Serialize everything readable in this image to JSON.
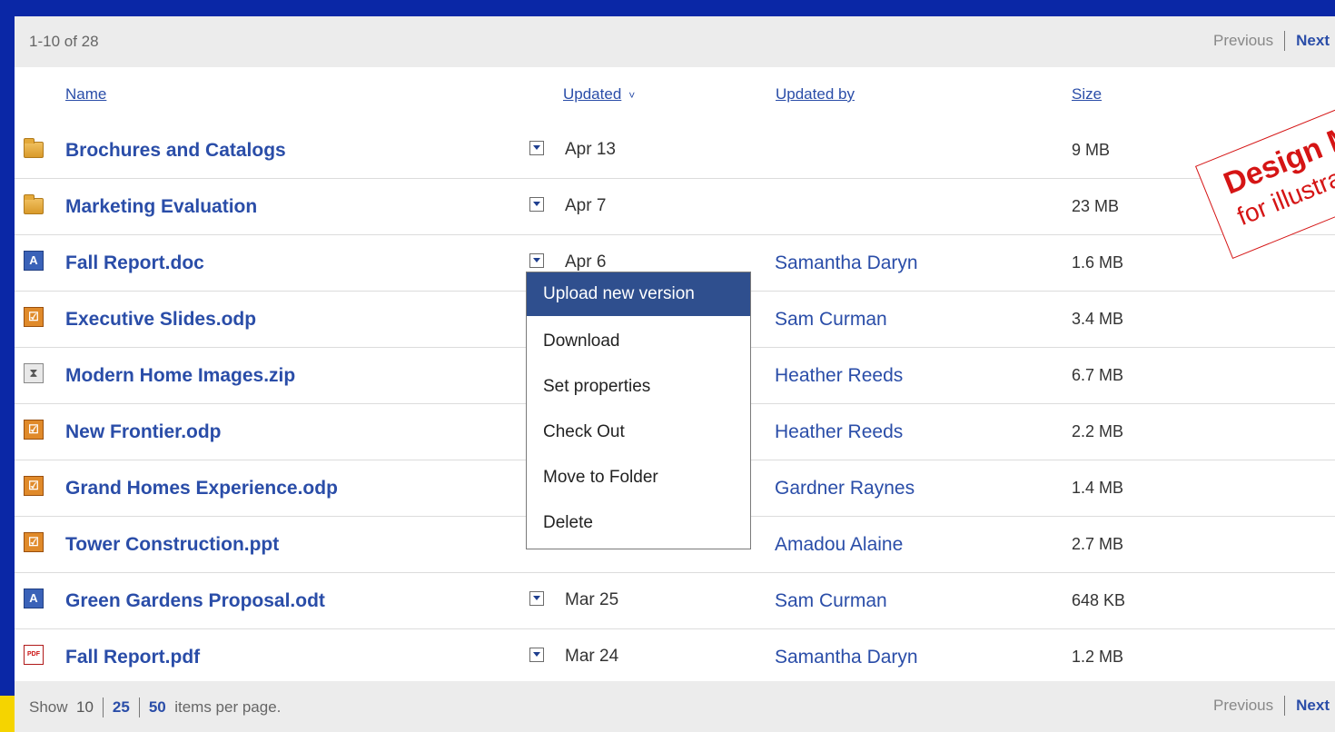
{
  "pager_top": {
    "range": "1-10 of 28",
    "previous": "Previous",
    "next": "Next"
  },
  "columns": {
    "name": "Name",
    "updated": "Updated",
    "updated_by": "Updated by",
    "size": "Size"
  },
  "rows": [
    {
      "name": "Brochures and Catalogs",
      "type": "folder",
      "updated": "Apr 13",
      "updated_by": "",
      "size": "9 MB"
    },
    {
      "name": "Marketing Evaluation",
      "type": "folder",
      "updated": "Apr 7",
      "updated_by": "",
      "size": "23 MB"
    },
    {
      "name": "Fall Report.doc",
      "type": "doc",
      "updated": "Apr 6",
      "updated_by": "Samantha Daryn",
      "size": "1.6 MB"
    },
    {
      "name": "Executive Slides.odp",
      "type": "odp",
      "updated": "",
      "updated_by": "Sam Curman",
      "size": "3.4 MB"
    },
    {
      "name": "Modern Home Images.zip",
      "type": "zip",
      "updated": "",
      "updated_by": "Heather Reeds",
      "size": "6.7 MB"
    },
    {
      "name": "New Frontier.odp",
      "type": "odp",
      "updated": "",
      "updated_by": "Heather Reeds",
      "size": "2.2 MB"
    },
    {
      "name": "Grand Homes Experience.odp",
      "type": "odp",
      "updated": "",
      "updated_by": "Gardner Raynes",
      "size": "1.4 MB"
    },
    {
      "name": "Tower Construction.ppt",
      "type": "odp",
      "updated": "",
      "updated_by": "Amadou Alaine",
      "size": "2.7 MB"
    },
    {
      "name": "Green Gardens Proposal.odt",
      "type": "doc",
      "updated": "Mar 25",
      "updated_by": "Sam Curman",
      "size": "648 KB"
    },
    {
      "name": "Fall Report.pdf",
      "type": "pdf",
      "updated": "Mar 24",
      "updated_by": "Samantha Daryn",
      "size": "1.2 MB"
    }
  ],
  "context_menu": {
    "items": [
      "Upload new version",
      "Download",
      "Set properties",
      "Check Out",
      "Move to Folder",
      "Delete"
    ],
    "active_index": 0
  },
  "pager_bottom": {
    "show": "Show",
    "opt_10": "10",
    "opt_25": "25",
    "opt_50": "50",
    "suffix": "items per page.",
    "previous": "Previous",
    "next": "Next"
  },
  "stamp": {
    "line1": "Design Mockup",
    "line2": "for illustration only"
  },
  "colors": {
    "background": "#0a27a6",
    "link": "#2a4da8",
    "menu_active": "#2f4f8e",
    "stamp": "#d51515"
  }
}
